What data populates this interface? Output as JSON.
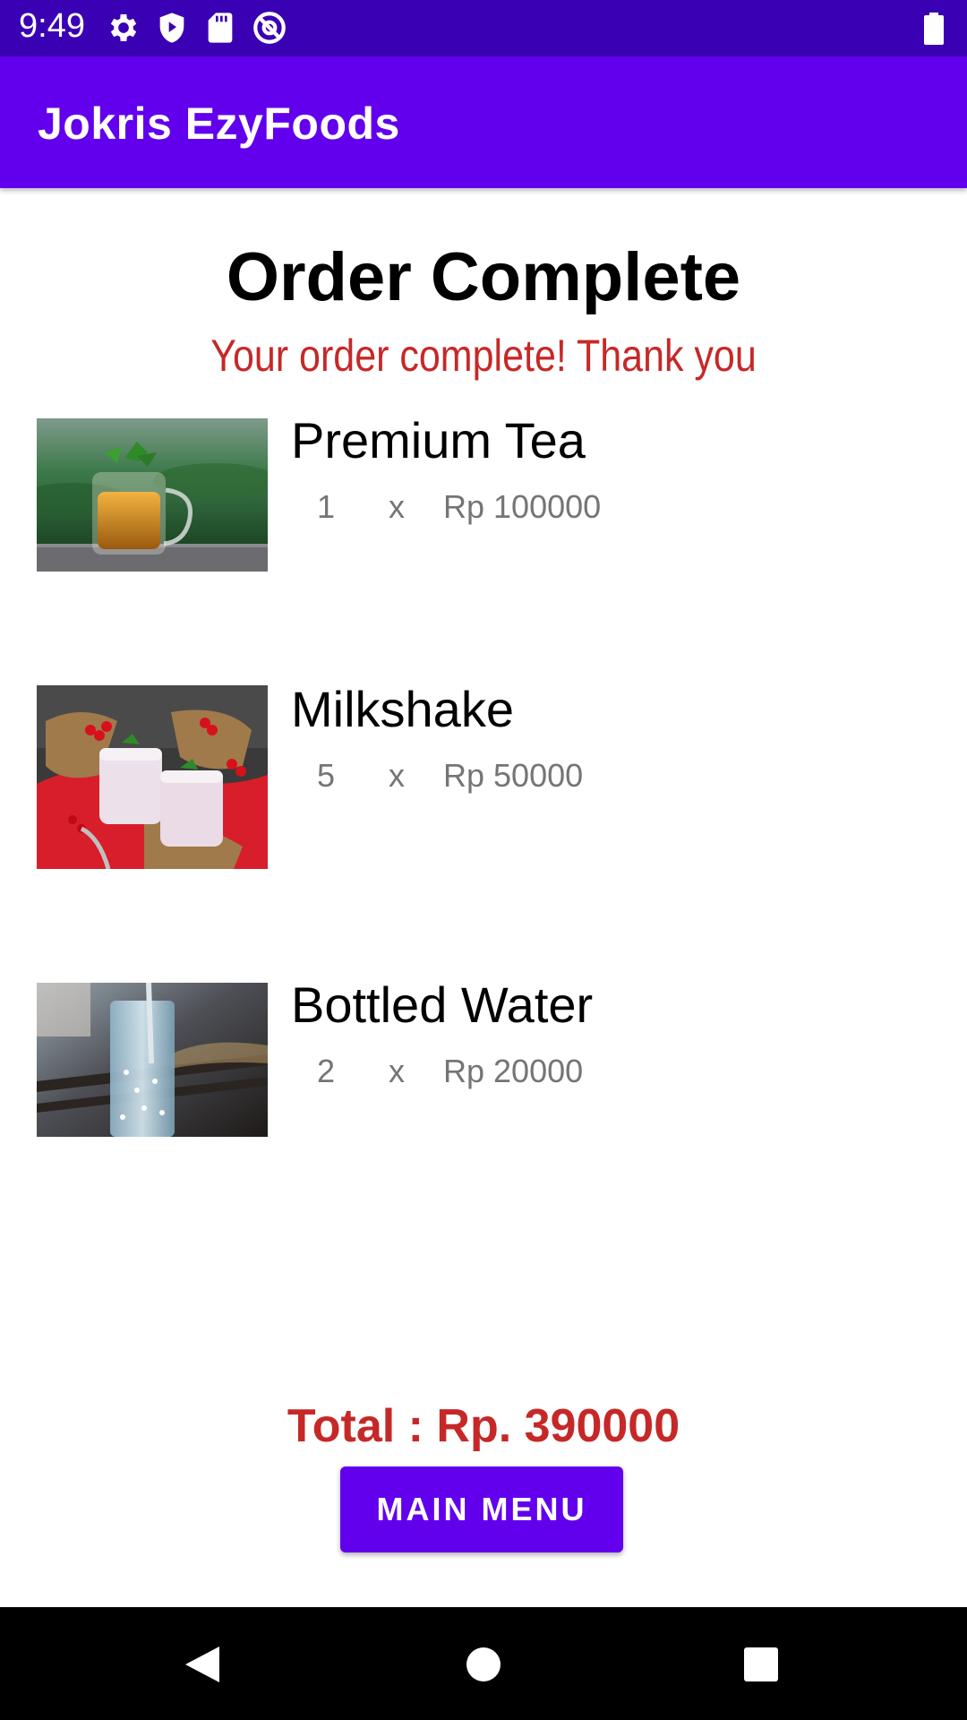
{
  "status_bar": {
    "time": "9:49",
    "icons": [
      "gear-icon",
      "shield-play-icon",
      "sd-card-icon",
      "at-sign-icon",
      "battery-icon"
    ]
  },
  "app_bar": {
    "title": "Jokris EzyFoods"
  },
  "page": {
    "title": "Order Complete",
    "subtitle": "Your order complete! Thank you"
  },
  "items": [
    {
      "name": "Premium Tea",
      "qty": "1",
      "x": "x",
      "price": "Rp 100000",
      "image": "tea-cup-photo"
    },
    {
      "name": "Milkshake",
      "qty": "5",
      "x": "x",
      "price": "Rp 50000",
      "image": "milkshake-photo"
    },
    {
      "name": "Bottled Water",
      "qty": "2",
      "x": "x",
      "price": "Rp 20000",
      "image": "water-glass-photo"
    }
  ],
  "summary": {
    "total": "Total : Rp. 390000",
    "button_label": "MAIN MENU"
  },
  "colors": {
    "status_bar": "#3a00b3",
    "app_bar": "#6200ee",
    "accent_red": "#c62828",
    "button": "#6200ee"
  },
  "nav_bar": {
    "buttons": [
      "back-icon",
      "home-icon",
      "recents-icon"
    ]
  }
}
